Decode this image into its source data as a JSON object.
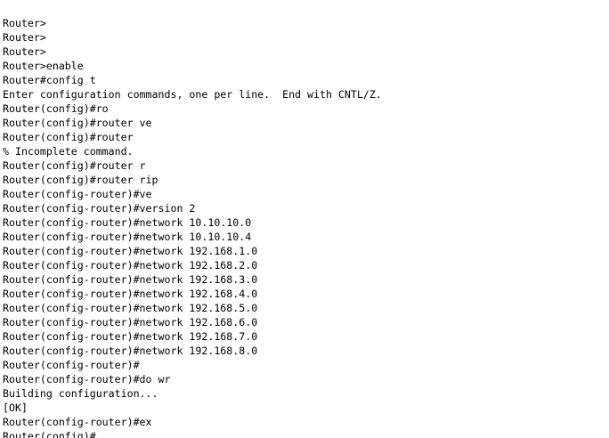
{
  "terminal": {
    "lines": [
      "Router>",
      "Router>",
      "Router>",
      "Router>enable",
      "Router#config t",
      "Enter configuration commands, one per line.  End with CNTL/Z.",
      "Router(config)#ro",
      "Router(config)#router ve",
      "Router(config)#router",
      "% Incomplete command.",
      "Router(config)#router r",
      "Router(config)#router rip",
      "Router(config-router)#ve",
      "Router(config-router)#version 2",
      "Router(config-router)#network 10.10.10.0",
      "Router(config-router)#network 10.10.10.4",
      "Router(config-router)#network 192.168.1.0",
      "Router(config-router)#network 192.168.2.0",
      "Router(config-router)#network 192.168.3.0",
      "Router(config-router)#network 192.168.4.0",
      "Router(config-router)#network 192.168.5.0",
      "Router(config-router)#network 192.168.6.0",
      "Router(config-router)#network 192.168.7.0",
      "Router(config-router)#network 192.168.8.0",
      "Router(config-router)#",
      "Router(config-router)#do wr",
      "Building configuration...",
      "[OK]",
      "Router(config-router)#ex",
      "Router(config)#"
    ]
  }
}
